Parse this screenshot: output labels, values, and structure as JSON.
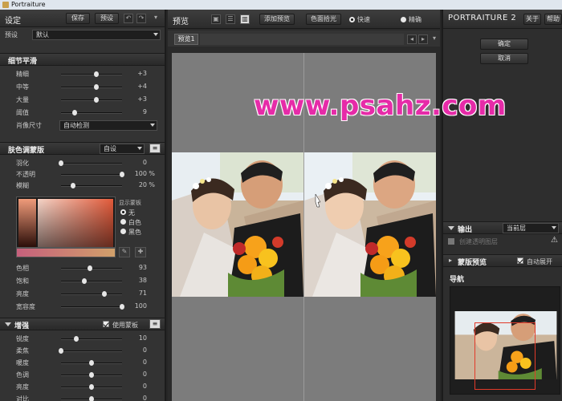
{
  "window": {
    "title": "Portraiture"
  },
  "left": {
    "header": {
      "title": "设定",
      "save": "保存",
      "preset": "预设"
    },
    "preset_row": {
      "label": "预设",
      "value": "默认"
    },
    "detail": {
      "title": "细节平滑",
      "sliders": [
        {
          "label": "精细",
          "value": "+3",
          "pos": 0.58
        },
        {
          "label": "中等",
          "value": "+4",
          "pos": 0.58
        },
        {
          "label": "大量",
          "value": "+3",
          "pos": 0.58
        },
        {
          "label": "阈值",
          "value": "9",
          "pos": 0.22
        }
      ],
      "portrait_size": {
        "label": "肖像尺寸",
        "value": "自动检测"
      }
    },
    "skin_mask": {
      "title": "肤色调蒙版",
      "mode": "自设",
      "sliders": [
        {
          "label": "羽化",
          "value": "0",
          "unit": "",
          "pos": 0.0
        },
        {
          "label": "不透明",
          "value": "100",
          "unit": "%",
          "pos": 1.0
        },
        {
          "label": "模糊",
          "value": "20",
          "unit": "%",
          "pos": 0.2
        }
      ],
      "show_mask": {
        "label": "显示蒙板",
        "options": [
          "无",
          "白色",
          "黑色"
        ],
        "selected": 0
      },
      "sliders2": [
        {
          "label": "色相",
          "value": "93",
          "pos": 0.47
        },
        {
          "label": "饱和",
          "value": "38",
          "pos": 0.38
        },
        {
          "label": "亮度",
          "value": "71",
          "pos": 0.71
        },
        {
          "label": "宽容度",
          "value": "100",
          "pos": 1.0
        }
      ]
    },
    "enhance": {
      "title": "增强",
      "use_mask_label": "使用蒙板",
      "use_mask_checked": true,
      "sliders": [
        {
          "label": "锐度",
          "value": "10",
          "pos": 0.25
        },
        {
          "label": "柔焦",
          "value": "0",
          "pos": 0.0
        },
        {
          "label": "暖度",
          "value": "0",
          "pos": 0.5
        },
        {
          "label": "色调",
          "value": "0",
          "pos": 0.5
        },
        {
          "label": "亮度",
          "value": "0",
          "pos": 0.5
        },
        {
          "label": "对比",
          "value": "0",
          "pos": 0.5
        }
      ]
    }
  },
  "center": {
    "toolbar": {
      "title": "预览",
      "add_preview": "添加预览",
      "color_pick": "色面拾光",
      "fast": "快速",
      "precise": "精确",
      "fast_checked": true,
      "precise_checked": false
    },
    "tab": "预览1"
  },
  "right": {
    "brand": "PORTRAITURE 2",
    "about": "关于",
    "help": "帮助",
    "ok": "确定",
    "cancel": "取消",
    "output": {
      "label": "输出",
      "value": "当前层",
      "new_layer": "创建透明图层"
    },
    "mask_preview": {
      "label": "蒙版预览",
      "auto_expand": "自动展开",
      "checked": true
    },
    "navigator": "导航"
  },
  "watermark": "www.psahz.com",
  "colors": {
    "accent_pink": "#e62ba8",
    "nav_frame": "#e23a2a"
  }
}
